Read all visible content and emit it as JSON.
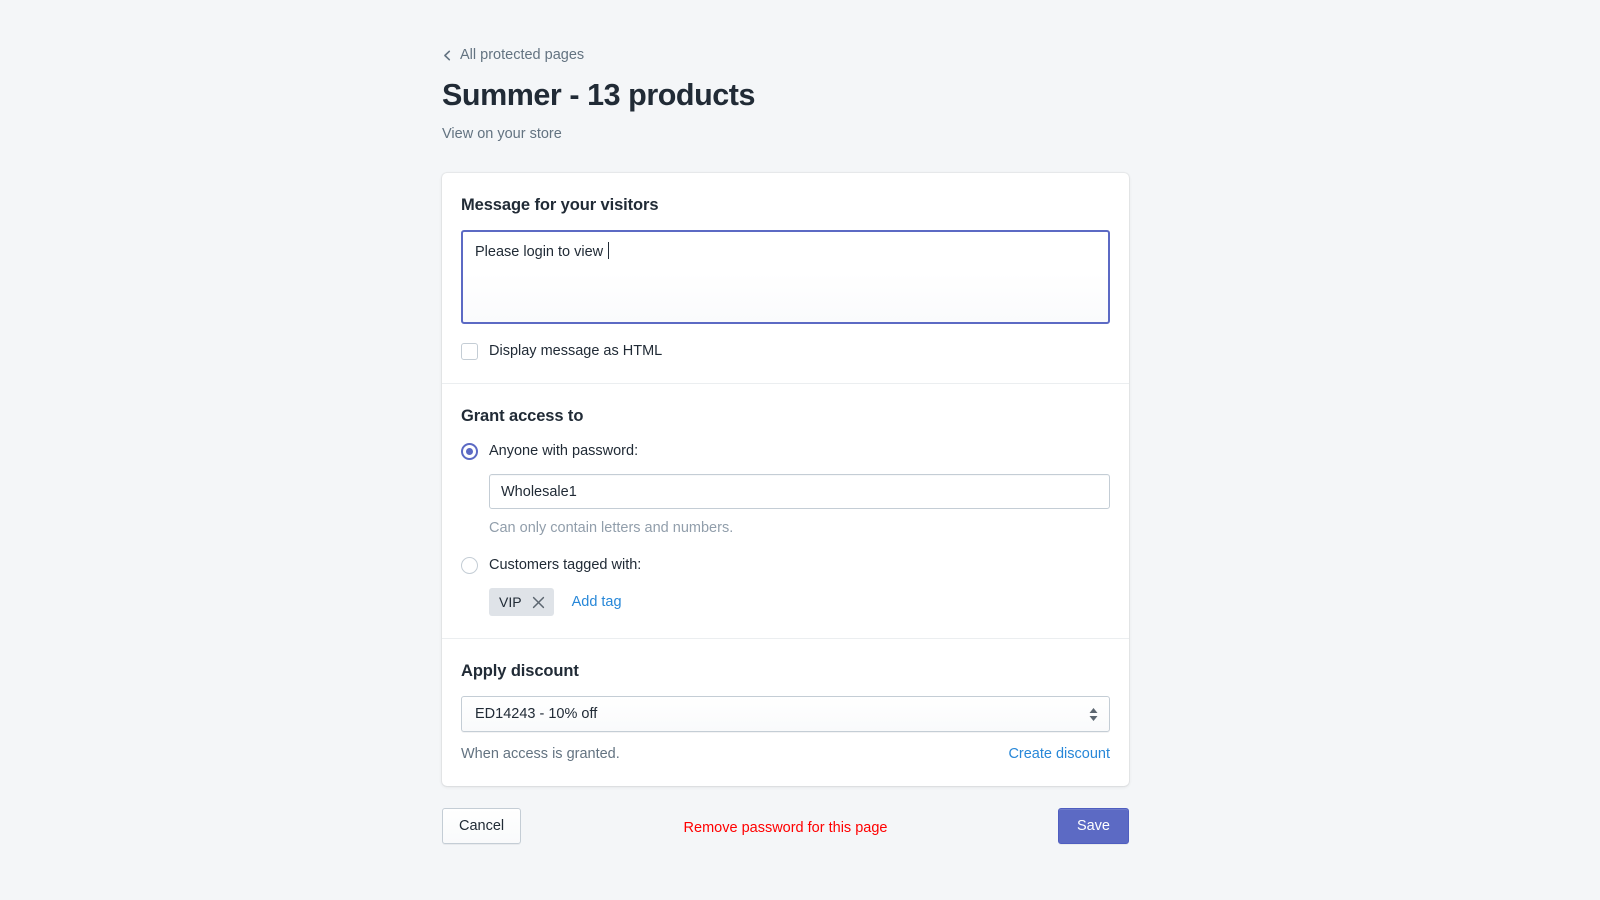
{
  "header": {
    "back_link": "All protected pages",
    "back_icon": "chevron-left-icon",
    "title": "Summer - 13 products",
    "view_store_link": "View on your store"
  },
  "message_section": {
    "title": "Message for your visitors",
    "textarea_value": "Please login to view",
    "textarea_placeholder": "",
    "html_checkbox_label": "Display message as HTML",
    "html_checkbox_checked": false
  },
  "access_section": {
    "title": "Grant access to",
    "password_option": {
      "label": "Anyone with password:",
      "selected": true,
      "password_value": "Wholesale1",
      "password_placeholder": "",
      "help_text": "Can only contain letters and numbers."
    },
    "tag_option": {
      "label": "Customers tagged with:",
      "selected": false,
      "tags": [
        "VIP"
      ],
      "remove_icon": "close-icon",
      "add_tag_label": "Add tag"
    }
  },
  "discount_section": {
    "title": "Apply discount",
    "selected_discount": "ED14243 - 10% off",
    "select_icon": "chevron-updown-icon",
    "footnote": "When access is granted.",
    "create_discount_label": "Create discount"
  },
  "actions": {
    "cancel_label": "Cancel",
    "remove_password_label": "Remove password for this page",
    "save_label": "Save"
  },
  "colors": {
    "page_background": "#f4f6f8",
    "accent_indigo": "#5c6ac4",
    "link_blue": "#2787d8",
    "destructive_red": "#ff0000",
    "text_primary": "#212b36",
    "text_subdued": "#637381"
  }
}
